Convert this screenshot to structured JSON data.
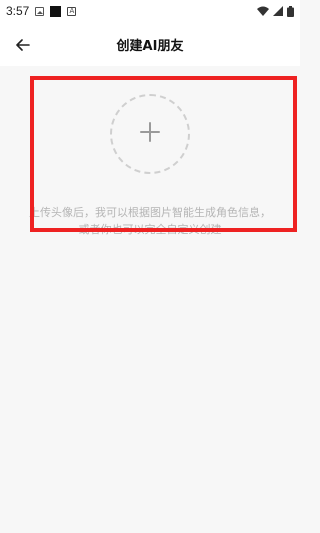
{
  "status_bar": {
    "time": "3:57"
  },
  "header": {
    "title": "创建AI朋友"
  },
  "upload": {
    "hint_line1": "上传头像后，我可以根据图片智能生成角色信息，",
    "hint_line2": "或者你也可以完全自定义创建"
  },
  "colors": {
    "highlight": "#ee2222",
    "dashed_border": "#cfcfcf",
    "hint_text": "#b5b5b5",
    "background": "#f7f7f7"
  }
}
